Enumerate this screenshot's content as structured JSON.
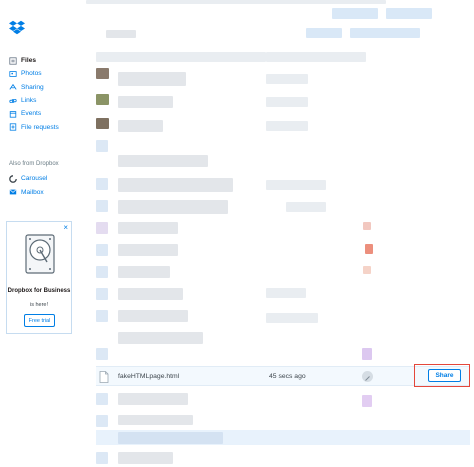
{
  "sidebar": {
    "nav": [
      {
        "label": "Files",
        "icon": "files-icon",
        "active": true
      },
      {
        "label": "Photos",
        "icon": "photos-icon"
      },
      {
        "label": "Sharing",
        "icon": "sharing-icon"
      },
      {
        "label": "Links",
        "icon": "links-icon"
      },
      {
        "label": "Events",
        "icon": "events-icon"
      },
      {
        "label": "File requests",
        "icon": "file-requests-icon"
      }
    ],
    "also_heading": "Also from Dropbox",
    "apps": [
      {
        "label": "Carousel",
        "icon": "carousel-icon"
      },
      {
        "label": "Mailbox",
        "icon": "mailbox-icon"
      }
    ],
    "promo": {
      "close": "×",
      "title": "Dropbox for Business",
      "subtitle": "is here!",
      "button": "Free trial"
    }
  },
  "file_row": {
    "name": "fakeHTMLpage.html",
    "modified": "45 secs ago",
    "share_label": "Share"
  },
  "colors": {
    "accent": "#007ee5",
    "highlight_box": "#e4473b",
    "row_highlight": "#f3f9fe"
  }
}
